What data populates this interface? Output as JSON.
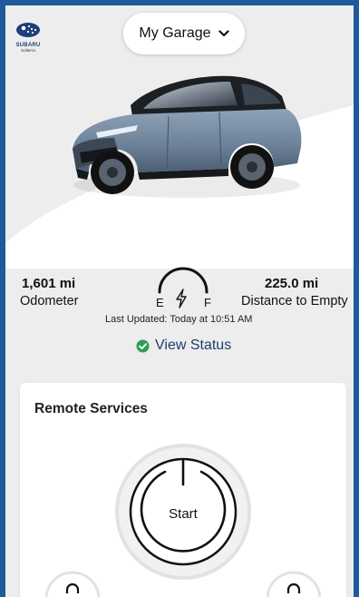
{
  "header": {
    "logo_text": "SUBARU",
    "logo_subtext": "Solterra",
    "garage_label": "My Garage"
  },
  "vehicle": {
    "odometer_value": "1,601 mi",
    "odometer_label": "Odometer",
    "distance_value": "225.0 mi",
    "distance_label": "Distance to Empty",
    "gauge_empty": "E",
    "gauge_full": "F",
    "last_updated": "Last Updated: Today at 10:51 AM",
    "view_status": "View Status"
  },
  "remote": {
    "title": "Remote Services",
    "start_label": "Start"
  },
  "icons": {
    "garage_chevron": "chevron-down-icon",
    "gauge_bolt": "lightning-bolt-icon",
    "status_check": "check-circle-icon",
    "start_power": "power-icon"
  },
  "colors": {
    "frame_border": "#1f5a9a",
    "status_check": "#2e9e57",
    "link_text": "#1e3d6d",
    "background": "#ededed"
  }
}
